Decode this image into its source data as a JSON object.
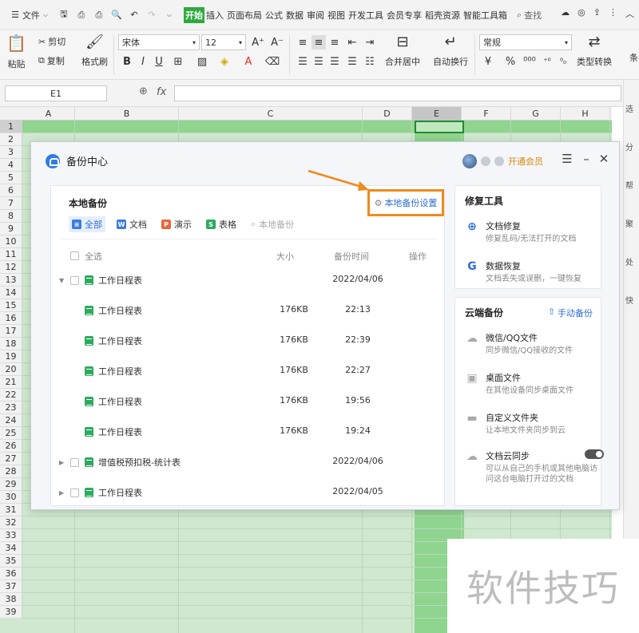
{
  "menubar": {
    "file_label": "文件",
    "tabs": [
      "开始",
      "插入",
      "页面布局",
      "公式",
      "数据",
      "审阅",
      "视图",
      "开发工具",
      "会员专享",
      "稻壳资源",
      "智能工具箱"
    ],
    "active_tab": "开始",
    "search_label": "查找"
  },
  "ribbon": {
    "paste": "粘贴",
    "cut": "剪切",
    "copy": "复制",
    "format_painter": "格式刷",
    "font_name": "宋体",
    "font_size": "12",
    "merge_center": "合并居中",
    "wrap_text": "自动换行",
    "number_format": "常规",
    "type_convert": "类型转换",
    "cond": "条"
  },
  "formula_bar": {
    "name_box": "E1",
    "fx": "fx",
    "content": ""
  },
  "grid": {
    "columns": [
      "A",
      "B",
      "C",
      "D",
      "E",
      "F",
      "G",
      "H"
    ],
    "selected_column": "E",
    "rows": [
      "1",
      "2",
      "3",
      "4",
      "5",
      "6",
      "7",
      "8",
      "9",
      "10",
      "11",
      "12",
      "13",
      "14",
      "15",
      "16",
      "17",
      "18",
      "19",
      "20",
      "21",
      "22",
      "23",
      "24",
      "25",
      "26",
      "27",
      "28",
      "29",
      "30",
      "31",
      "32",
      "33",
      "34",
      "35",
      "36",
      "37",
      "38",
      "39"
    ]
  },
  "task_pane": [
    "选",
    "分",
    "帮",
    "聚",
    "处",
    "快"
  ],
  "dialog": {
    "title": "备份中心",
    "member_label": "开通会员",
    "local": {
      "title": "本地备份",
      "settings_label": "本地备份设置",
      "filters": [
        {
          "label": "全部",
          "icon": "list-icon",
          "color": "#3b7ddd"
        },
        {
          "label": "文档",
          "icon": "W",
          "color": "#3b7ddd"
        },
        {
          "label": "演示",
          "icon": "P",
          "color": "#e8673b"
        },
        {
          "label": "表格",
          "icon": "S",
          "color": "#2eaa5f"
        }
      ],
      "search_placeholder": "本地备份",
      "headers": {
        "select_all": "全选",
        "size": "大小",
        "time": "备份时间",
        "action": "操作"
      },
      "files": [
        {
          "name": "工作日程表",
          "size": "",
          "time": "2022/04/06",
          "group": true,
          "expanded": true
        },
        {
          "name": "工作日程表",
          "size": "176KB",
          "time": "22:13",
          "group": false
        },
        {
          "name": "工作日程表",
          "size": "176KB",
          "time": "22:39",
          "group": false
        },
        {
          "name": "工作日程表",
          "size": "176KB",
          "time": "22:27",
          "group": false
        },
        {
          "name": "工作日程表",
          "size": "176KB",
          "time": "19:56",
          "group": false
        },
        {
          "name": "工作日程表",
          "size": "176KB",
          "time": "19:24",
          "group": false
        },
        {
          "name": "增值税预扣税-统计表",
          "size": "",
          "time": "2022/04/06",
          "group": true,
          "expanded": false
        },
        {
          "name": "工作日程表",
          "size": "",
          "time": "2022/04/05",
          "group": true,
          "expanded": false
        }
      ]
    },
    "repair": {
      "title": "修复工具",
      "items": [
        {
          "title": "文档修复",
          "desc": "修复乱码/无法打开的文档"
        },
        {
          "title": "数据恢复",
          "desc": "文档丢失或误删，一键恢复"
        }
      ]
    },
    "cloud": {
      "title": "云端备份",
      "action": "手动备份",
      "items": [
        {
          "title": "微信/QQ文件",
          "desc": "同步微信/QQ接收的文件"
        },
        {
          "title": "桌面文件",
          "desc": "在其他设备同步桌面文件"
        },
        {
          "title": "自定义文件夹",
          "desc": "让本地文件夹同步到云"
        },
        {
          "title": "文档云同步",
          "desc": "可以从自己的手机或其他电脑访问这台电脑打开过的文档"
        }
      ]
    }
  },
  "watermark": "软件技巧",
  "colors": {
    "accent_green": "#2eaa3f",
    "highlight_orange": "#f08a1c",
    "link_blue": "#2f6fd6"
  }
}
